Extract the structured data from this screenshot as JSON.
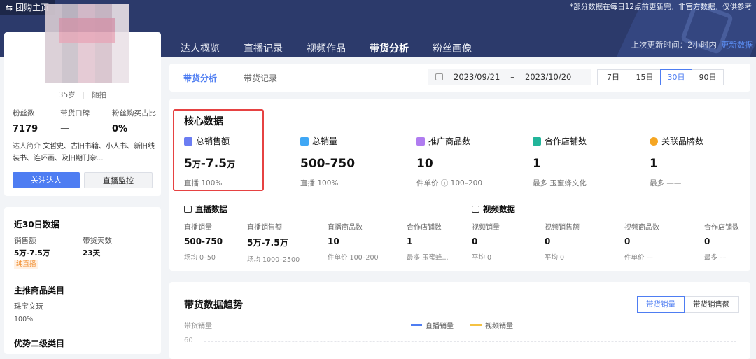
{
  "header": {
    "back_label": "团购主页",
    "notice": "*部分数据在每日12点前更新完，非官方数据，仅供参考",
    "tabs": [
      "达人概览",
      "直播记录",
      "视频作品",
      "带货分析",
      "粉丝画像"
    ],
    "update_prefix": "上次更新时间：",
    "update_value": "2小时内",
    "update_link": "更新数据"
  },
  "profile": {
    "age": "35岁",
    "type": "随拍",
    "stats": [
      {
        "label": "粉丝数",
        "value": "7179"
      },
      {
        "label": "带货口碑",
        "value": "—"
      },
      {
        "label": "粉丝购买占比",
        "value": "0%"
      }
    ],
    "intro_key": "达人简介",
    "intro_text": "文哲史、古旧书籍、小人书、新旧线装书、连环画、及旧期刊杂...",
    "follow_btn": "关注达人",
    "monitor_btn": "直播监控"
  },
  "side2": {
    "title": "近30日数据",
    "sales_lbl": "销售额",
    "sales_val": "5万-7.5万",
    "days_lbl": "带货天数",
    "days_val": "23天",
    "tag": "纯直播",
    "cat_title": "主推商品类目",
    "cat_name": "珠宝文玩",
    "cat_pct": "100%",
    "sub_title": "优势二级类目"
  },
  "subnav": {
    "tabs": [
      "带货分析",
      "带货记录"
    ],
    "date_from": "2023/09/21",
    "date_sep": "–",
    "date_to": "2023/10/20",
    "ranges": [
      "7日",
      "15日",
      "30日",
      "90日"
    ]
  },
  "core": {
    "title": "核心数据",
    "metrics": [
      {
        "label": "总销售额",
        "value_a": "5",
        "unit_a": "万",
        "dash": "-",
        "value_b": "7.5",
        "unit_b": "万",
        "sub": "直播 100%",
        "color": "#6b7df2"
      },
      {
        "label": "总销量",
        "value": "500-750",
        "sub": "直播 100%",
        "color": "#3fa7f5"
      },
      {
        "label": "推广商品数",
        "value": "10",
        "sub": "件单价 ⓘ 100–200",
        "color": "#b07cf0"
      },
      {
        "label": "合作店铺数",
        "value": "1",
        "sub": "最多 玉蜜蜂文化",
        "color": "#22b59a"
      },
      {
        "label": "关联品牌数",
        "value": "1",
        "sub": "最多 ——",
        "color": "#f5a623"
      }
    ]
  },
  "live": {
    "title": "直播数据",
    "items": [
      {
        "l": "直播销量",
        "v": "500-750",
        "f": "场均 0–50"
      },
      {
        "l": "直播销售额",
        "v": "5万-7.5万",
        "f": "场均 1000–2500"
      },
      {
        "l": "直播商品数",
        "v": "10",
        "f": "件单价 100–200"
      },
      {
        "l": "合作店铺数",
        "v": "1",
        "f": "最多 玉蜜蜂..."
      }
    ]
  },
  "video": {
    "title": "视频数据",
    "items": [
      {
        "l": "视频销量",
        "v": "0",
        "f": "平均 0"
      },
      {
        "l": "视频销售额",
        "v": "0",
        "f": "平均 0"
      },
      {
        "l": "视频商品数",
        "v": "0",
        "f": "件单价 ––"
      },
      {
        "l": "合作店铺数",
        "v": "0",
        "f": "最多 ––"
      }
    ]
  },
  "trend": {
    "title": "带货数据趋势",
    "buttons": [
      "带货销量",
      "带货销售额"
    ],
    "ylabel": "带货销量",
    "legend": [
      {
        "name": "直播销量",
        "color": "#4e7df2"
      },
      {
        "name": "视频销量",
        "color": "#f5c242"
      }
    ],
    "tick": "60"
  }
}
